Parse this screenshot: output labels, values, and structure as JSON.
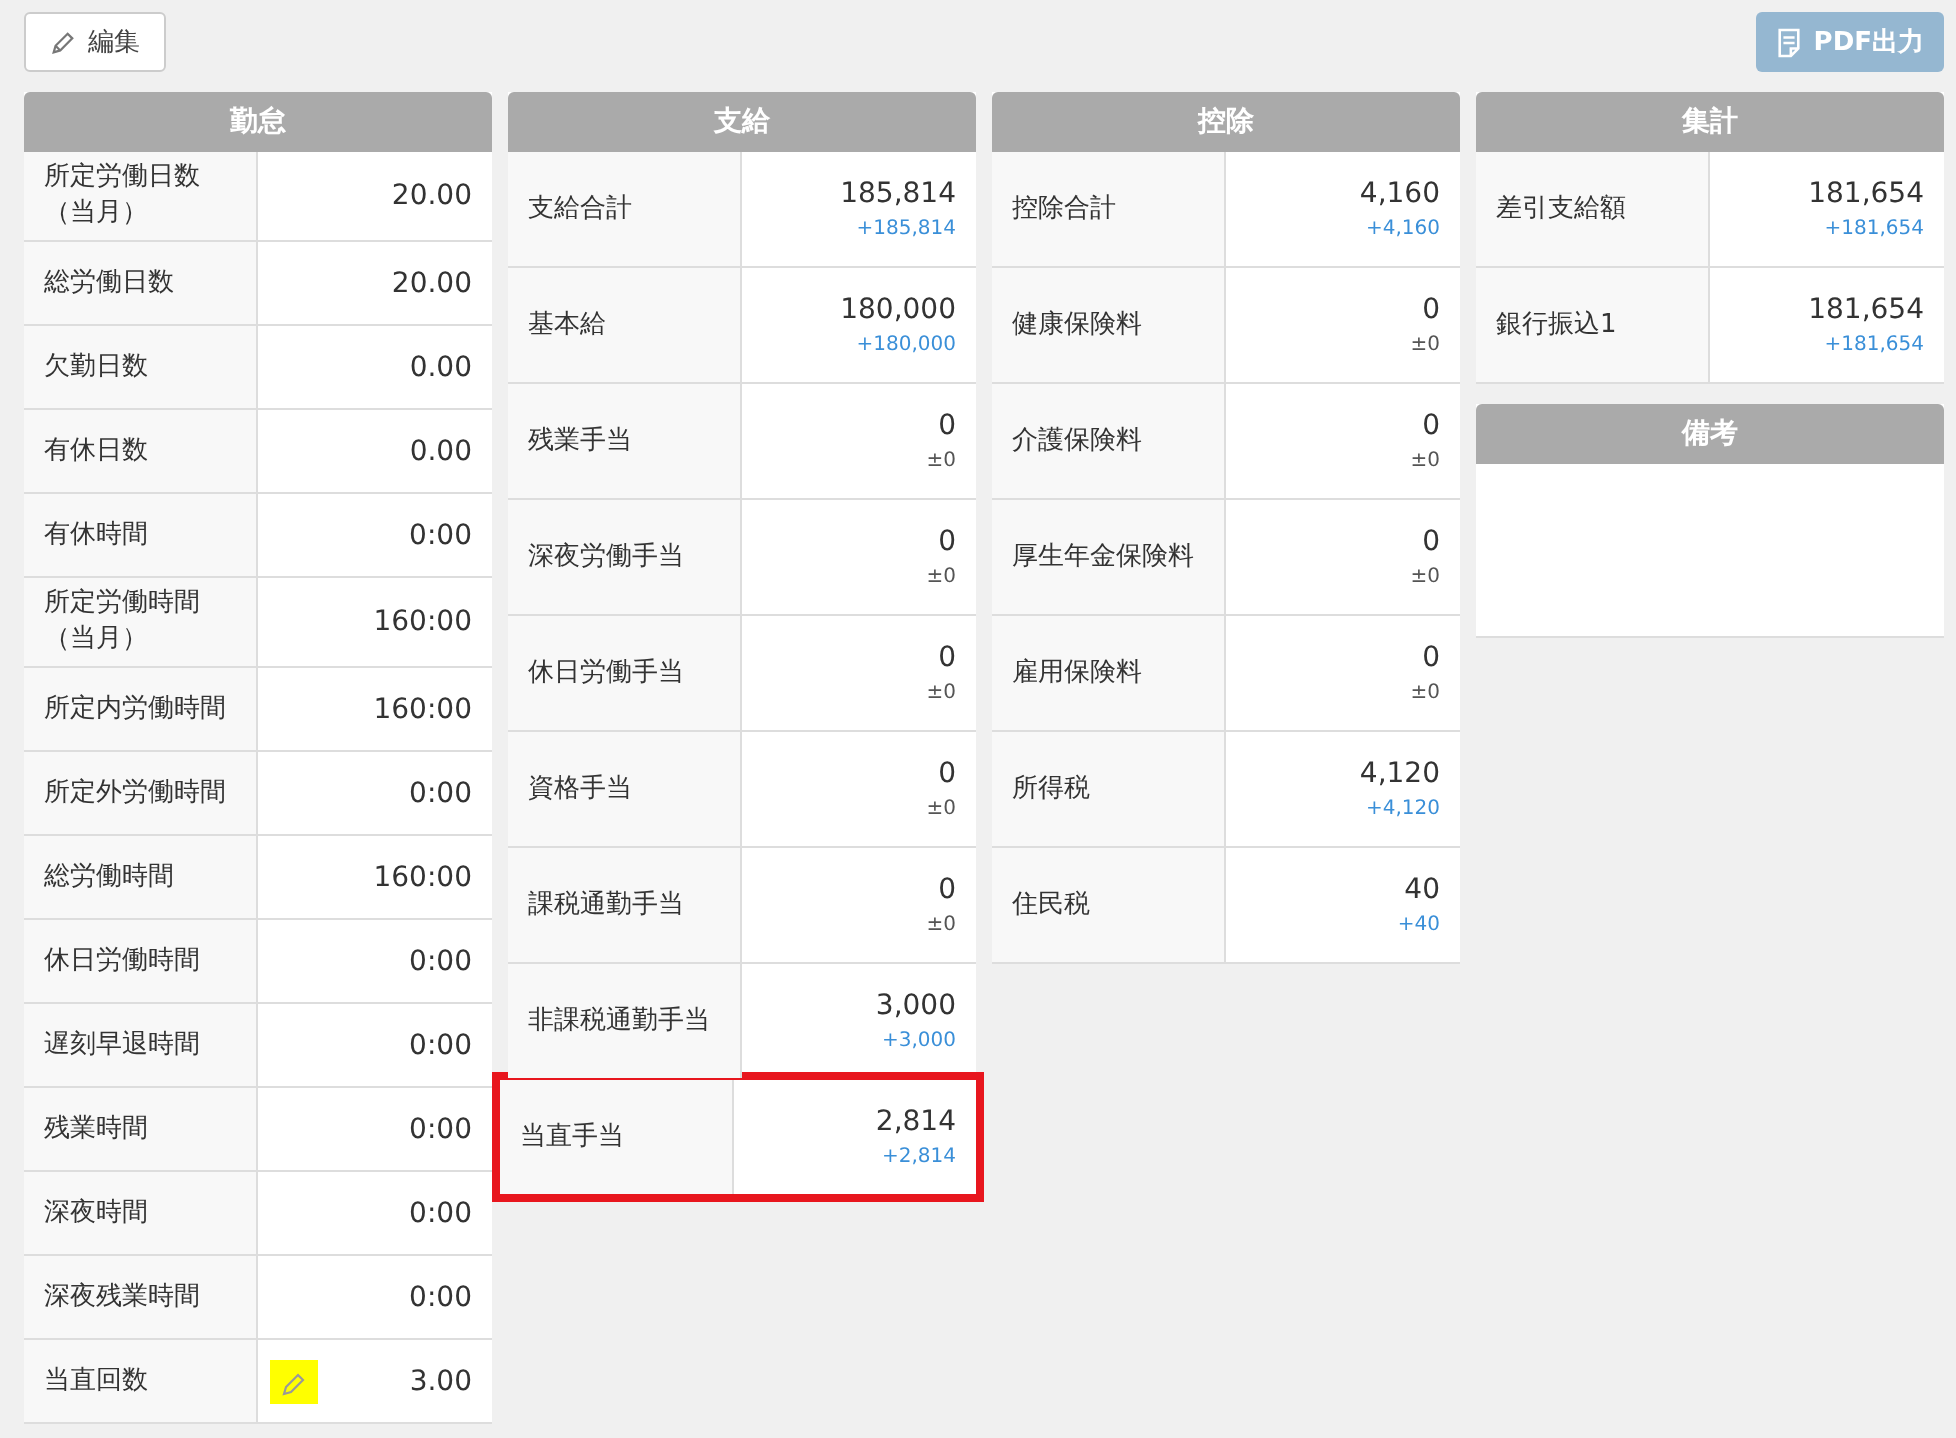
{
  "toolbar": {
    "edit_button": "編集",
    "pdf_button": "PDF出力",
    "pdf_disabled": true
  },
  "panels": [
    {
      "title": "勤怠",
      "kind": "attendance",
      "rows": [
        {
          "label": "所定労働日数（当月）",
          "value": "20.00",
          "edited": false
        },
        {
          "label": "総労働日数",
          "value": "20.00",
          "edited": false
        },
        {
          "label": "欠勤日数",
          "value": "0.00",
          "edited": false
        },
        {
          "label": "有休日数",
          "value": "0.00",
          "edited": false
        },
        {
          "label": "有休時間",
          "value": "0:00",
          "edited": false
        },
        {
          "label": "所定労働時間（当月）",
          "value": "160:00",
          "edited": false
        },
        {
          "label": "所定内労働時間",
          "value": "160:00",
          "edited": false
        },
        {
          "label": "所定外労働時間",
          "value": "0:00",
          "edited": false
        },
        {
          "label": "総労働時間",
          "value": "160:00",
          "edited": false
        },
        {
          "label": "休日労働時間",
          "value": "0:00",
          "edited": false
        },
        {
          "label": "遅刻早退時間",
          "value": "0:00",
          "edited": false
        },
        {
          "label": "残業時間",
          "value": "0:00",
          "edited": false
        },
        {
          "label": "深夜時間",
          "value": "0:00",
          "edited": false
        },
        {
          "label": "深夜残業時間",
          "value": "0:00",
          "edited": false
        },
        {
          "label": "当直回数",
          "value": "3.00",
          "edited": true
        }
      ]
    },
    {
      "title": "支給",
      "kind": "amounts",
      "rows": [
        {
          "label": "支給合計",
          "value": "185,814",
          "diff": "+185,814",
          "kind": "increase",
          "highlighted": false
        },
        {
          "label": "基本給",
          "value": "180,000",
          "diff": "+180,000",
          "kind": "increase",
          "highlighted": false
        },
        {
          "label": "残業手当",
          "value": "0",
          "diff": "±0",
          "kind": "zero",
          "highlighted": false
        },
        {
          "label": "深夜労働手当",
          "value": "0",
          "diff": "±0",
          "kind": "zero",
          "highlighted": false
        },
        {
          "label": "休日労働手当",
          "value": "0",
          "diff": "±0",
          "kind": "zero",
          "highlighted": false
        },
        {
          "label": "資格手当",
          "value": "0",
          "diff": "±0",
          "kind": "zero",
          "highlighted": false
        },
        {
          "label": "課税通勤手当",
          "value": "0",
          "diff": "±0",
          "kind": "zero",
          "highlighted": false
        },
        {
          "label": "非課税通勤手当",
          "value": "3,000",
          "diff": "+3,000",
          "kind": "increase",
          "highlighted": false
        },
        {
          "label": "当直手当",
          "value": "2,814",
          "diff": "+2,814",
          "kind": "increase",
          "highlighted": true
        }
      ]
    },
    {
      "title": "控除",
      "kind": "amounts",
      "rows": [
        {
          "label": "控除合計",
          "value": "4,160",
          "diff": "+4,160",
          "kind": "increase",
          "highlighted": false
        },
        {
          "label": "健康保険料",
          "value": "0",
          "diff": "±0",
          "kind": "zero",
          "highlighted": false
        },
        {
          "label": "介護保険料",
          "value": "0",
          "diff": "±0",
          "kind": "zero",
          "highlighted": false
        },
        {
          "label": "厚生年金保険料",
          "value": "0",
          "diff": "±0",
          "kind": "zero",
          "highlighted": false
        },
        {
          "label": "雇用保険料",
          "value": "0",
          "diff": "±0",
          "kind": "zero",
          "highlighted": false
        },
        {
          "label": "所得税",
          "value": "4,120",
          "diff": "+4,120",
          "kind": "increase",
          "highlighted": false
        },
        {
          "label": "住民税",
          "value": "40",
          "diff": "+40",
          "kind": "increase",
          "highlighted": false
        }
      ]
    },
    {
      "title": "集計",
      "kind": "amounts",
      "rows": [
        {
          "label": "差引支給額",
          "value": "181,654",
          "diff": "+181,654",
          "kind": "increase",
          "highlighted": false
        },
        {
          "label": "銀行振込1",
          "value": "181,654",
          "diff": "+181,654",
          "kind": "increase",
          "highlighted": false
        }
      ]
    },
    {
      "title": "備考",
      "kind": "notes"
    }
  ]
}
